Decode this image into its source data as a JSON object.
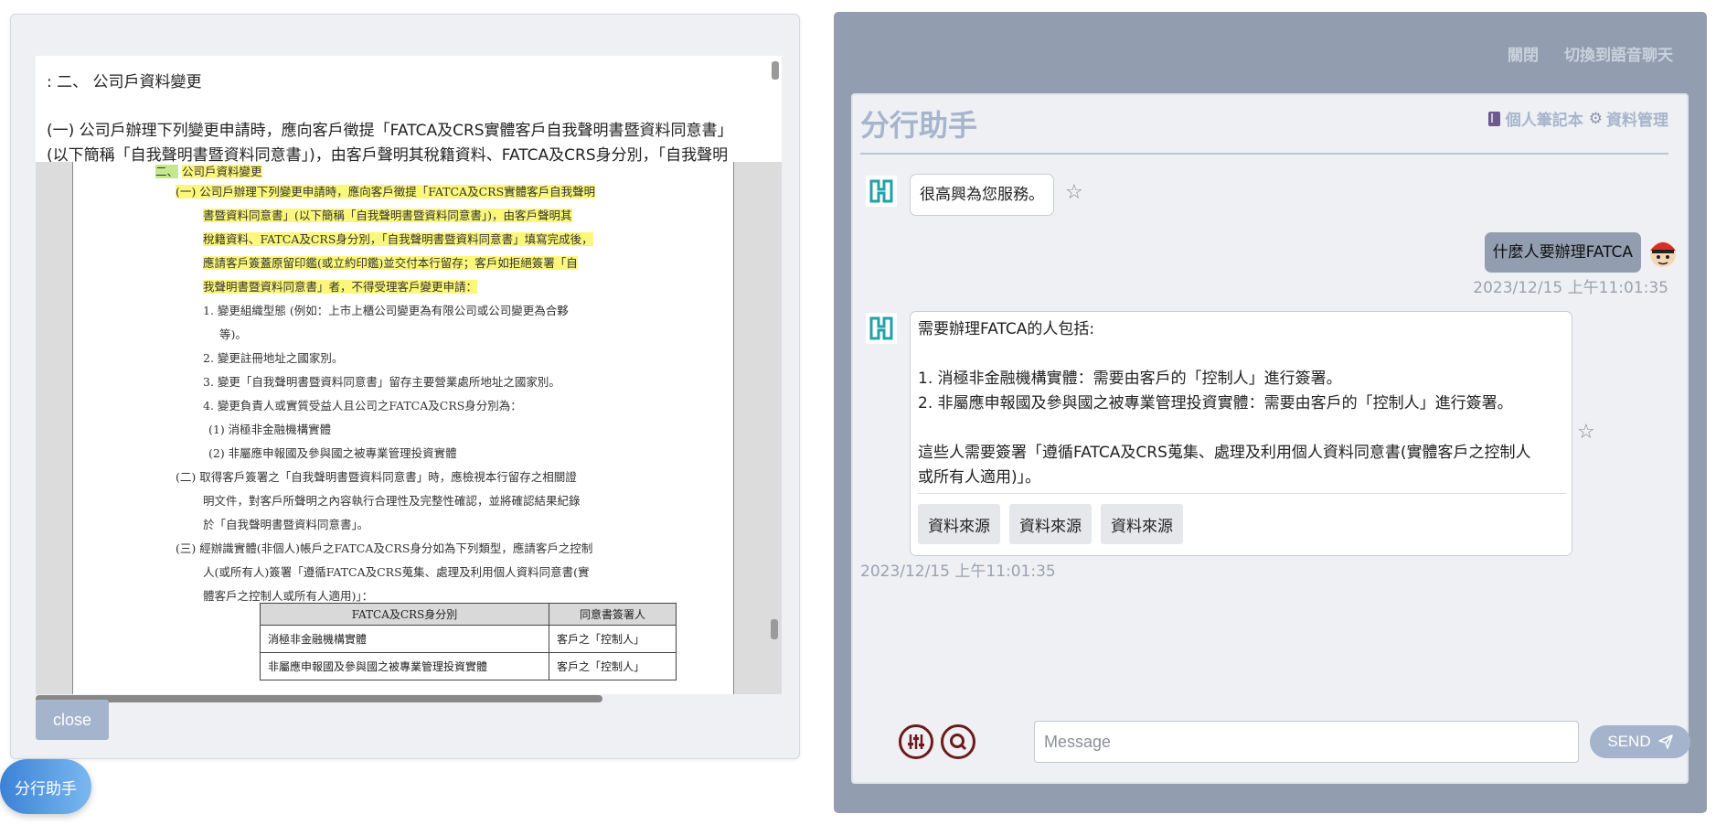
{
  "doc_viewer": {
    "text_lines": [
      ": 二、 公司戶資料變更",
      "",
      "(一) 公司戶辦理下列變更申請時，應向客戶徵提「FATCA及CRS實體客戶自我聲明書暨資料同意書」",
      "(以下簡稱「自我聲明書暨資料同意書」)，由客戶聲明其稅籍資料、FATCA及CRS身分別，「自我聲明"
    ],
    "scan": {
      "heading_num": "二、",
      "heading": "公司戶資料變更",
      "lines": [
        "(一) 公司戶辦理下列變更申請時，應向客戶徵提「FATCA及CRS實體客戶自我聲明",
        "書暨資料同意書」(以下簡稱「自我聲明書暨資料同意書」)，由客戶聲明其",
        "稅籍資料、FATCA及CRS身分別，「自我聲明書暨資料同意書」填寫完成後，",
        "應請客戶簽蓋原留印鑑(或立約印鑑)並交付本行留存；客戶如拒絕簽署「自",
        "我聲明書暨資料同意書」者，不得受理客戶變更申請：",
        "1. 變更組織型態 (例如：上市上櫃公司變更為有限公司或公司變更為合夥",
        "等)。",
        "2. 變更註冊地址之國家別。",
        "3. 變更「自我聲明書暨資料同意書」留存主要營業處所地址之國家別。",
        "4. 變更負責人或實質受益人且公司之FATCA及CRS身分別為：",
        "(1) 消極非金融機構實體",
        "(2) 非屬應申報國及參與國之被專業管理投資實體",
        "(二) 取得客戶簽署之「自我聲明書暨資料同意書」時，應檢視本行留存之相關證",
        "明文件，對客戶所聲明之內容執行合理性及完整性確認，並將確認結果紀錄",
        "於「自我聲明書暨資料同意書」。",
        "(三) 經辦識實體(非個人)帳戶之FATCA及CRS身分如為下列類型，應請客戶之控制",
        "人(或所有人)簽署「遵循FATCA及CRS蒐集、處理及利用個人資料同意書(實",
        "體客戶之控制人或所有人適用)」："
      ],
      "table_headers": [
        "FATCA及CRS身分別",
        "同意書簽署人"
      ],
      "table_rows": [
        [
          "消極非金融機構實體",
          "客戶之「控制人」"
        ],
        [
          "非屬應申報國及參與國之被專業管理投資實體",
          "客戶之「控制人」"
        ]
      ]
    },
    "close_label": "close"
  },
  "fab_label": "分行助手",
  "chat": {
    "top_links": [
      "關閉",
      "切換到語音聊天"
    ],
    "title": "分行助手",
    "notebook_label": "個人筆記本",
    "data_mgmt_label": "資料管理",
    "messages": {
      "greeting": "很高興為您服務。",
      "user_question": "什麼人要辦理FATCA",
      "user_timestamp": "2023/12/15 上午11:01:35",
      "answer_lines": [
        "需要辦理FATCA的人包括:",
        "",
        "1. 消極非金融機構實體：需要由客戶的「控制人」進行簽署。",
        "2. 非屬應申報國及參與國之被專業管理投資實體：需要由客戶的「控制人」進行簽署。",
        "",
        "這些人需要簽署「遵循FATCA及CRS蒐集、處理及利用個人資料同意書(實體客戶之控制人",
        "或所有人適用)」。"
      ],
      "sources": [
        "資料來源",
        "資料來源",
        "資料來源"
      ],
      "answer_timestamp": "2023/12/15 上午11:01:35"
    },
    "input_placeholder": "Message",
    "send_label": "SEND"
  },
  "colors": {
    "accent": "#a3b4cc",
    "chat_frame": "#929eb0",
    "highlight": "#fbf77a",
    "icon_dark_red": "#6d1a1a"
  }
}
